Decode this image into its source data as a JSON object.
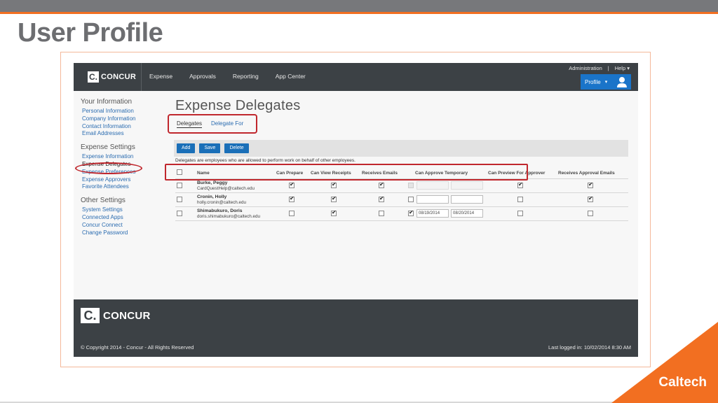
{
  "slide": {
    "title": "User Profile",
    "brand": "Caltech",
    "colors": {
      "accent": "#f26f21",
      "band": "#77787b",
      "annotation": "#c0272d"
    }
  },
  "app": {
    "logo_mark": "C.",
    "logo_text": "CONCUR",
    "nav": [
      "Expense",
      "Approvals",
      "Reporting",
      "App Center"
    ],
    "utility": {
      "administration": "Administration",
      "separator": "|",
      "help": "Help ▾"
    },
    "profile_label": "Profile",
    "profile_caret": "▾",
    "colors": {
      "nav_bg": "#3c4145",
      "primary": "#1a74c9",
      "link": "#2b6cb0"
    }
  },
  "sidebar": {
    "groups": [
      {
        "heading": "Your Information",
        "items": [
          "Personal Information",
          "Company Information",
          "Contact Information",
          "Email Addresses"
        ]
      },
      {
        "heading": "Expense Settings",
        "items": [
          "Expense Information",
          "Expense Delegates",
          "Expense Preferences",
          "Expense Approvers",
          "Favorite Attendees"
        ]
      },
      {
        "heading": "Other Settings",
        "items": [
          "System Settings",
          "Connected Apps",
          "Concur Connect",
          "Change Password"
        ]
      }
    ],
    "active_item": "Expense Delegates"
  },
  "main": {
    "title": "Expense Delegates",
    "tabs": [
      {
        "label": "Delegates",
        "active": true
      },
      {
        "label": "Delegate For",
        "active": false
      }
    ],
    "buttons": {
      "add": "Add",
      "save": "Save",
      "delete": "Delete"
    },
    "description": "Delegates are employees who are allowed to perform work on behalf of other employees.",
    "columns": [
      "Name",
      "Can Prepare",
      "Can View Receipts",
      "Receives Emails",
      "Can Approve Temporary",
      "Can Preview For Approver",
      "Receives Approval Emails"
    ],
    "rows": [
      {
        "name": "Burke, Peggy",
        "email": "CardQuestHelp@caltech.edu",
        "can_prepare": true,
        "can_view_receipts": true,
        "receives_emails": true,
        "can_approve_temporary": false,
        "approve_disabled": true,
        "start_date": "",
        "end_date": "",
        "can_preview": true,
        "receives_approval_emails": true
      },
      {
        "name": "Cronin, Holly",
        "email": "holly.cronin@caltech.edu",
        "can_prepare": true,
        "can_view_receipts": true,
        "receives_emails": true,
        "can_approve_temporary": false,
        "approve_disabled": false,
        "start_date": "",
        "end_date": "",
        "can_preview": false,
        "receives_approval_emails": true
      },
      {
        "name": "Shimabukuro, Doris",
        "email": "doris.shimabukuro@caltech.edu",
        "can_prepare": false,
        "can_view_receipts": true,
        "receives_emails": false,
        "can_approve_temporary": true,
        "approve_disabled": false,
        "start_date": "08/19/2014",
        "end_date": "08/20/2014",
        "can_preview": false,
        "receives_approval_emails": false
      }
    ]
  },
  "footer": {
    "logo_mark": "C.",
    "logo_text": "CONCUR",
    "copyright": "© Copyright 2014 - Concur - All Rights Reserved",
    "last_logged": "Last logged in: 10/02/2014 8:30 AM"
  }
}
